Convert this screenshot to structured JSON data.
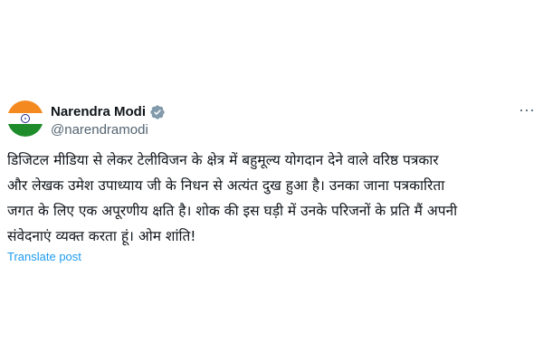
{
  "author": {
    "name": "Narendra Modi",
    "handle": "@narendramodi",
    "avatar_icon": "india-flag-icon",
    "verified_icon": "verified-badge-icon"
  },
  "post": {
    "lines": [
      "डिजिटल मीडिया से लेकर टेलीविजन के क्षेत्र में बहुमूल्य योगदान देने वाले वरिष्ठ पत्रकार",
      "और लेखक उमेश उपाध्याय जी के निधन से अत्यंत दुख हुआ है। उनका जाना पत्रकारिता",
      "जगत के लिए एक अपूरणीय क्षति है। शोक की इस घड़ी में उनके परिजनों के प्रति मैं अपनी",
      "संवेदनाएं व्यक्त करता हूं। ओम शांति!"
    ],
    "translate_label": "Translate post"
  },
  "menu": {
    "more_label": "···",
    "more_icon": "more-options-icon"
  },
  "colors": {
    "text": "#0f1419",
    "muted": "#536471",
    "link": "#1d9bf0",
    "badge": "#829aab"
  }
}
